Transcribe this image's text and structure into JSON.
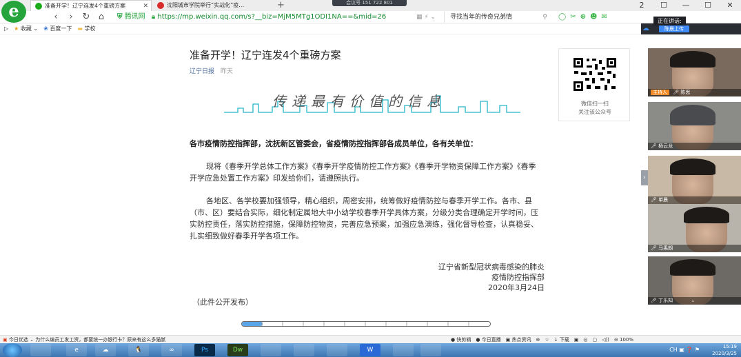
{
  "browser": {
    "logo": "e",
    "tabs": [
      {
        "title": "准备开学！辽宁连发4个重磅方案",
        "icon_color": "#1aad19",
        "active": true
      },
      {
        "title": "沈阳城市学院举行“实战化”疫…",
        "icon_color": "#d92b2b",
        "active": false
      }
    ],
    "new_tab": "+",
    "meeting_id": "会议号 151 722 801",
    "window_controls": [
      "2",
      "☐",
      "—",
      "☐",
      "✕"
    ],
    "nav": [
      "‹",
      "›",
      "↻",
      "⌂"
    ],
    "site_name": "腾讯网",
    "url": "https://mp.weixin.qq.com/s?__biz=MjM5MTg1ODI1NA==&mid=26",
    "url_tools": "▦ ⚡ ⌄",
    "search_placeholder": "寻找当年的传奇兄弟情",
    "toolbar_icons": [
      "◯",
      "✂",
      "⊕",
      "☻",
      "✉"
    ]
  },
  "bookmarks": [
    {
      "label": "收藏",
      "icon": "star-icon"
    },
    {
      "label": "百度一下",
      "icon": "paw-icon"
    },
    {
      "label": "学校",
      "icon": "folder-icon"
    }
  ],
  "article": {
    "title": "准备开学！辽宁连发4个重磅方案",
    "source": "辽宁日报",
    "date": "昨天",
    "banner_text": "传递最有价值的信息",
    "addressee": "各市疫情防控指挥部，沈抚新区管委会，省疫情防控指挥部各成员单位，各有关单位：",
    "paragraph1": "现将《春季开学总体工作方案》《春季开学疫情防控工作方案》《春季开学物资保障工作方案》《春季开学应急处置工作方案》印发给你们，请遵照执行。",
    "paragraph2": "各地区、各学校要加强领导，精心组织，周密安排，统筹做好疫情防控与春季开学工作。各市、县（市、区）要结合实际，细化制定属地大中小幼学校春季开学具体方案，分级分类合理确定开学时间，压实防控责任，落实防控措施，保障防控物资，完善应急预案，加强应急演练，强化督导检查，认真稳妥、扎实细致做好春季开学各项工作。",
    "signature_line1": "辽宁省新型冠状病毒感染的肺炎",
    "signature_line2": "疫情防控指挥部",
    "signature_date": "2020年3月24日",
    "public_note": "（此件公开发布）"
  },
  "qr": {
    "caption_line1": "微信扫一扫",
    "caption_line2": "关注该公众号"
  },
  "infobar": {
    "left_label": "今日优选",
    "headline": "为什么编员工发工资，都要统一办银行卡？原来有这么多猫腻",
    "right_items": "● 快剪辑　● 今日直播　▣ 热点资讯　⊕　☆　↓ 下载　▣　◎　▢　◁))　⊖ 100%"
  },
  "meeting": {
    "speaking_label": "正在讲话:",
    "speaker_badge": "陈晨上传",
    "participants": [
      {
        "name": "陈思",
        "host": true,
        "host_label": "主持人"
      },
      {
        "name": "杨云龙",
        "host": false
      },
      {
        "name": "单晨",
        "host": false
      },
      {
        "name": "马禹朗",
        "host": false
      },
      {
        "name": "丁乐知",
        "host": false
      }
    ]
  },
  "taskbar": {
    "apps": [
      "",
      "",
      "e",
      "☁",
      "🐧",
      "∞",
      "Ps",
      "Dw",
      "",
      "",
      "",
      "W",
      "",
      ""
    ],
    "tray": "CH ▣ ❓ ⚑",
    "time": "15:19",
    "date": "2020/3/25"
  }
}
